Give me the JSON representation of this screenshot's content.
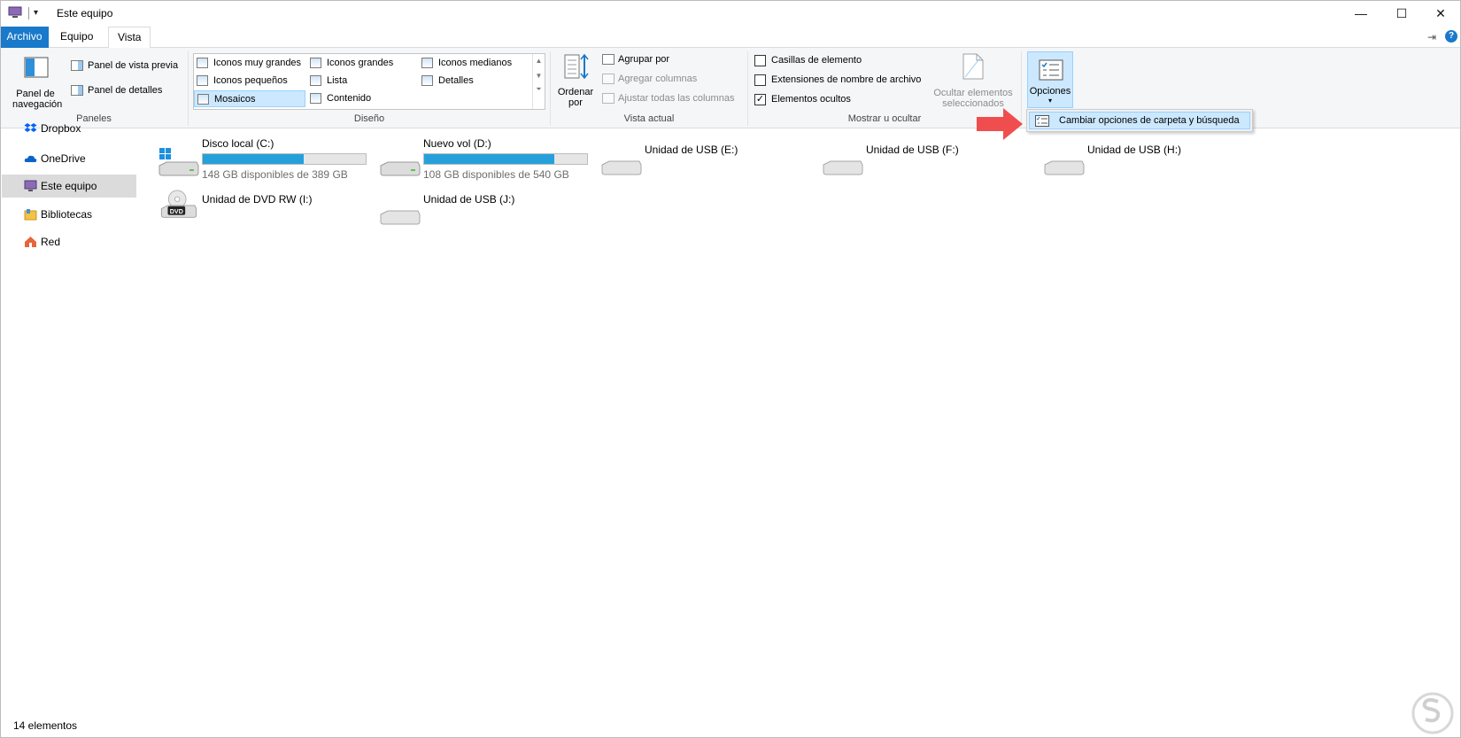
{
  "window": {
    "title": "Este equipo",
    "controls": [
      "minimize-icon",
      "maximize-icon",
      "close-icon"
    ]
  },
  "tabs": [
    {
      "label": "Archivo"
    },
    {
      "label": "Equipo"
    },
    {
      "label": "Vista"
    }
  ],
  "ribbon": {
    "panels_group": {
      "nav_pane_label": "Panel de navegación",
      "preview_pane_label": "Panel de vista previa",
      "details_pane_label": "Panel de detalles",
      "group_label": "Paneles"
    },
    "layout_group": {
      "items": [
        "Iconos muy grandes",
        "Iconos grandes",
        "Iconos medianos",
        "Iconos pequeños",
        "Lista",
        "Detalles",
        "Mosaicos",
        "Contenido"
      ],
      "selected": "Mosaicos",
      "group_label": "Diseño"
    },
    "current_view_group": {
      "sort_label": "Ordenar por",
      "group_by_label": "Agrupar por",
      "add_columns_label": "Agregar columnas",
      "fit_columns_label": "Ajustar todas las columnas",
      "group_label": "Vista actual"
    },
    "show_hide_group": {
      "item_checkboxes_label": "Casillas de elemento",
      "item_checkboxes_checked": false,
      "extensions_label": "Extensiones de nombre de archivo",
      "extensions_checked": false,
      "hidden_items_label": "Elementos ocultos",
      "hidden_items_checked": true,
      "hide_selected_label": "Ocultar elementos seleccionados",
      "group_label": "Mostrar u ocultar"
    },
    "options": {
      "label": "Opciones",
      "menu_item": "Cambiar opciones de carpeta y búsqueda"
    }
  },
  "nav_pane": {
    "items": [
      {
        "label": "Dropbox",
        "icon": "dropbox-icon"
      },
      {
        "label": "OneDrive",
        "icon": "onedrive-icon"
      },
      {
        "label": "Este equipo",
        "icon": "computer-icon",
        "selected": true
      },
      {
        "label": "Bibliotecas",
        "icon": "libraries-icon"
      },
      {
        "label": "Red",
        "icon": "network-icon"
      }
    ]
  },
  "drives": [
    {
      "name": "Disco local (C:)",
      "free": "148 GB disponibles de 389 GB",
      "used_fraction": 0.62,
      "icon": "windows-drive-icon"
    },
    {
      "name": "Nuevo vol (D:)",
      "free": "108 GB disponibles de 540 GB",
      "used_fraction": 0.8,
      "icon": "hard-drive-icon"
    },
    {
      "name": "Unidad de USB (E:)",
      "icon": "usb-drive-icon"
    },
    {
      "name": "Unidad de USB (F:)",
      "icon": "usb-drive-icon"
    },
    {
      "name": "Unidad de USB (H:)",
      "icon": "usb-drive-icon"
    },
    {
      "name": "Unidad de DVD RW (I:)",
      "icon": "dvd-drive-icon",
      "dvd_label": "DVD"
    },
    {
      "name": "Unidad de USB (J:)",
      "icon": "usb-drive-icon"
    }
  ],
  "status": {
    "item_count": "14 elementos"
  },
  "colors": {
    "accent": "#1979ca",
    "selection": "#cce8ff",
    "drive_bar": "#26a0da",
    "arrow": "#f04e4e"
  }
}
